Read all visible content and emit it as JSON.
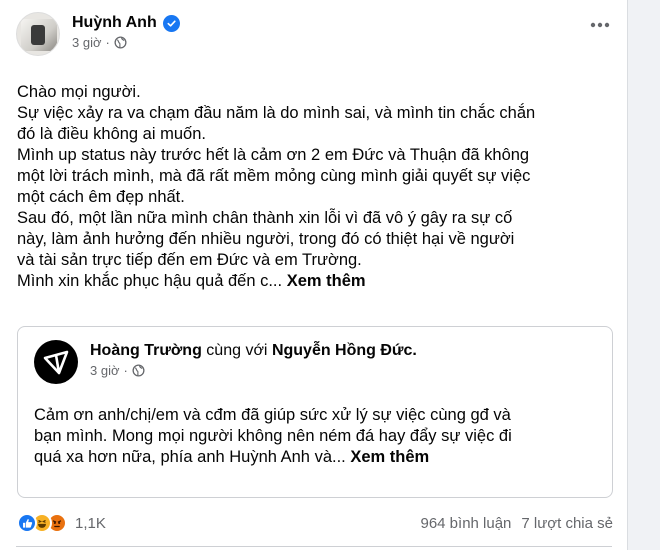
{
  "post": {
    "author": "Huỳnh Anh",
    "time": "3 giờ",
    "privacy_icon": "globe-icon",
    "more_icon": "more-icon",
    "body_lines": [
      "Chào mọi người.",
      "Sự việc xảy ra va chạm đầu năm là do mình sai, và mình tin chắc chắn",
      "đó là điều không ai muốn.",
      "Mình up status này trước hết là cảm ơn 2 em Đức và Thuận đã không",
      "một lời trách mình, mà đã rất mềm mỏng cùng mình giải quyết sự việc",
      "một cách êm đẹp nhất.",
      "Sau đó, một lần nữa mình chân thành xin lỗi vì đã vô ý gây ra sự cố",
      "này, làm ảnh hưởng đến nhiều người, trong đó có thiệt hại về người",
      "và tài sản trực tiếp đến em Đức và em Trường."
    ],
    "last_line": "Mình xin khắc phục hậu quả đến c...",
    "see_more": "Xem thêm"
  },
  "shared": {
    "author": "Hoàng Trường",
    "with_text": "cùng với",
    "tagged": "Nguyễn Hồng Đức.",
    "time": "3 giờ",
    "body_lines": [
      "Cảm ơn anh/chị/em và cđm đã giúp sức xử lý sự việc cùng gđ và",
      "bạn mình. Mong mọi người không nên ném đá hay đẩy sự việc đi"
    ],
    "last_line": "quá xa hơn nữa, phía anh Huỳnh Anh và...",
    "see_more": "Xem thêm"
  },
  "footer": {
    "reactions": [
      "like",
      "haha",
      "angry"
    ],
    "reaction_count": "1,1K",
    "comments": "964 bình luận",
    "shares": "7 lượt chia sẻ"
  },
  "colors": {
    "accent": "#1877f2",
    "secondary_text": "#65676b",
    "border": "#ced0d4"
  }
}
